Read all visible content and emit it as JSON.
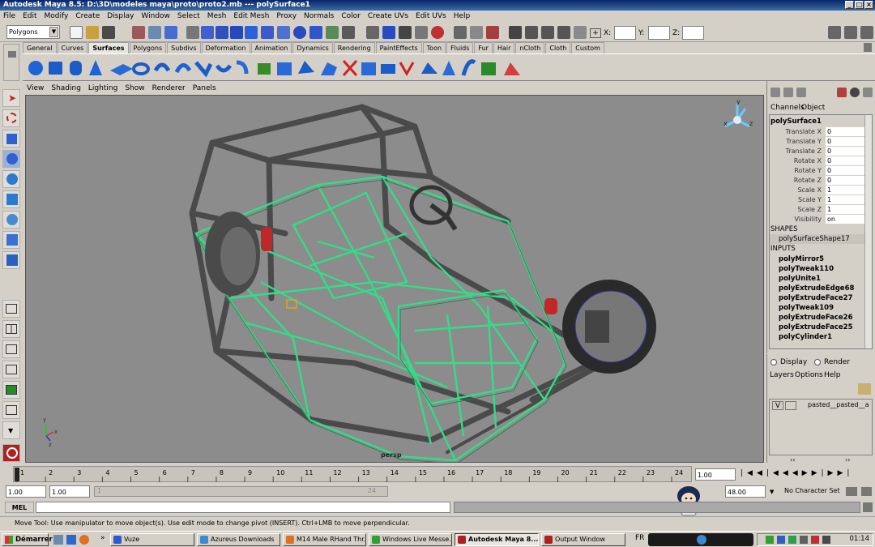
{
  "window": {
    "title": "Autodesk Maya 8.5: D:\\3D\\modeles maya\\proto\\proto2.mb   ---   polySurface1"
  },
  "menu": [
    "File",
    "Edit",
    "Modify",
    "Create",
    "Display",
    "Window",
    "Select",
    "Mesh",
    "Edit Mesh",
    "Proxy",
    "Normals",
    "Color",
    "Create UVs",
    "Edit UVs",
    "Help"
  ],
  "status": {
    "mode": "Polygons",
    "x_label": "X:",
    "y_label": "Y:",
    "z_label": "Z:"
  },
  "shelf_tabs": [
    "General",
    "Curves",
    "Surfaces",
    "Polygons",
    "Subdivs",
    "Deformation",
    "Animation",
    "Dynamics",
    "Rendering",
    "PaintEffects",
    "Toon",
    "Fluids",
    "Fur",
    "Hair",
    "nCloth",
    "Cloth",
    "Custom"
  ],
  "shelf_active": "Surfaces",
  "panel_menu": [
    "View",
    "Shading",
    "Lighting",
    "Show",
    "Renderer",
    "Panels"
  ],
  "viewport": {
    "camera_label": "persp",
    "axis_x": "x",
    "axis_y": "y",
    "axis_z": "z"
  },
  "channel_box": {
    "tabs": [
      "Channels",
      "Object"
    ],
    "object": "polySurface1",
    "channels": [
      {
        "name": "Translate X",
        "value": "0"
      },
      {
        "name": "Translate Y",
        "value": "0"
      },
      {
        "name": "Translate Z",
        "value": "0"
      },
      {
        "name": "Rotate X",
        "value": "0"
      },
      {
        "name": "Rotate Y",
        "value": "0"
      },
      {
        "name": "Rotate Z",
        "value": "0"
      },
      {
        "name": "Scale X",
        "value": "1"
      },
      {
        "name": "Scale Y",
        "value": "1"
      },
      {
        "name": "Scale Z",
        "value": "1"
      },
      {
        "name": "Visibility",
        "value": "on"
      }
    ],
    "shapes_header": "SHAPES",
    "shape": "polySurfaceShape17",
    "inputs_header": "INPUTS",
    "inputs": [
      "polyMirror5",
      "polyTweak110",
      "polyUnite1",
      "polyExtrudeEdge68",
      "polyExtrudeFace27",
      "polyTweak109",
      "polyExtrudeFace26",
      "polyExtrudeFace25",
      "polyCylinder1"
    ]
  },
  "layer_editor": {
    "display_label": "Display",
    "render_label": "Render",
    "menu": [
      "Layers",
      "Options",
      "Help"
    ],
    "layer_visible": "V",
    "layer_name": "pasted__pasted__a"
  },
  "timeline": {
    "ticks": [
      "1",
      "2",
      "3",
      "4",
      "5",
      "6",
      "7",
      "8",
      "9",
      "10",
      "11",
      "12",
      "13",
      "14",
      "15",
      "16",
      "17",
      "18",
      "19",
      "20",
      "21",
      "22",
      "23",
      "24"
    ],
    "current_frame": "1.00"
  },
  "range": {
    "start": "1.00",
    "start2": "1.00",
    "slider_start": "1",
    "slider_end": "24",
    "end": "48.00",
    "character": "No Character Set"
  },
  "command": {
    "label": "MEL"
  },
  "help_line": "Move Tool: Use manipulator to move object(s). Use edit mode to change pivot (INSERT).  Ctrl+LMB to move perpendicular.",
  "taskbar": {
    "start": "Démarrer",
    "tasks": [
      "Vuze",
      "Azureus Downloads",
      "M14 Male RHand Thr...",
      "Windows Live Messe...",
      "Autodesk Maya 8....",
      "Output Window"
    ],
    "active_task": "Autodesk Maya 8....",
    "language": "FR",
    "clock": "01:14"
  }
}
